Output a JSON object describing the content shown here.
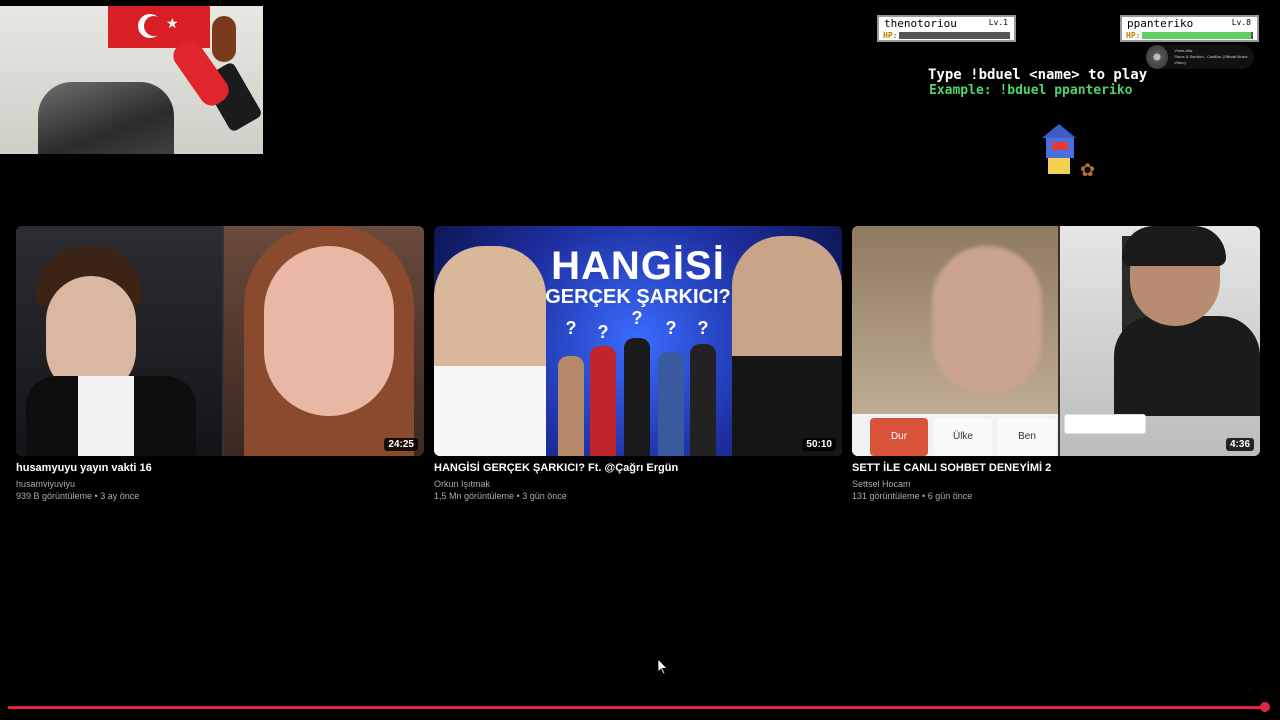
{
  "overlay": {
    "duel_players": [
      {
        "name": "thenotoriou",
        "level": "Lv.1",
        "hp_label": "HP:",
        "hp_fraction": 0.0
      },
      {
        "name": "ppanteriko",
        "level": "Lv.8",
        "hp_label": "HP:",
        "hp_fraction": 0.98
      }
    ],
    "now_playing": {
      "title": "Vinda Alta",
      "subtitle": "Stone & Sanford - Cadillac (Official Music Video)"
    },
    "instruction": "Type !bduel <name> to play",
    "example": "Example: !bduel ppanteriko"
  },
  "videos": [
    {
      "title": "husamyuyu yayın vakti 16",
      "channel": "husamviyuviyu",
      "meta": "939 B görüntüleme • 3 ay önce",
      "duration": "24:25"
    },
    {
      "title": "HANGİSİ GERÇEK ŞARKICI? Ft. @Çağrı Ergün",
      "channel": "Orkun Işıtmak",
      "meta": "1,5 Mn görüntüleme • 3 gün önce",
      "duration": "50:10",
      "thumb_text": {
        "headline": "HANGİSİ",
        "subline": "GERÇEK ŞARKICI?"
      }
    },
    {
      "title": "SETT İLE CANLI SOHBET DENEYİMİ 2",
      "channel": "Settsel Hocam",
      "meta": "131 görüntüleme • 6 gün önce",
      "duration": "4:36",
      "thumb_buttons": [
        "Dur",
        "Ülke",
        "Ben"
      ]
    }
  ],
  "player": {
    "progress_fraction": 0.998
  },
  "colors": {
    "accent_red": "#e3263f",
    "hp_green": "#5fcf5f",
    "example_green": "#4fd36a"
  }
}
